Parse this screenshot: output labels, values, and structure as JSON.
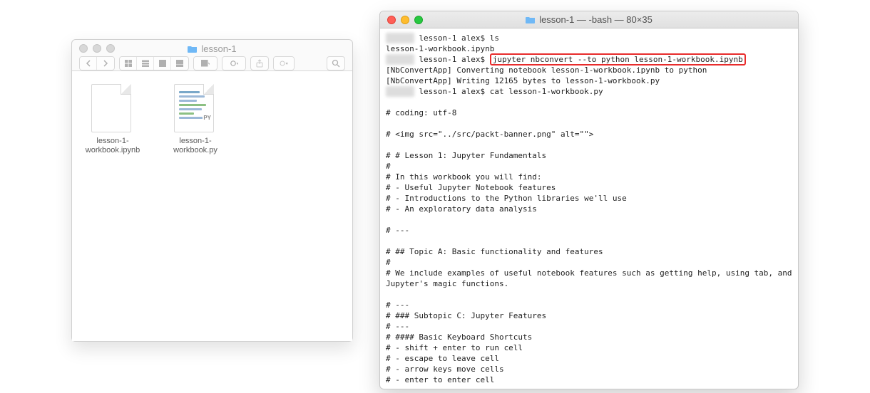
{
  "finder": {
    "title": "lesson-1",
    "files": [
      {
        "name": "lesson-1-workbook.ipynb",
        "kind": "ipynb"
      },
      {
        "name": "lesson-1-workbook.py",
        "kind": "py"
      }
    ]
  },
  "terminal": {
    "title": "lesson-1 — -bash — 80×35",
    "prompt_hidden": "██████",
    "lines": {
      "p1_dir": " lesson-1 alex$ ",
      "p1_cmd": "ls",
      "lsout": "lesson-1-workbook.ipynb",
      "p2_dir": " lesson-1 alex$ ",
      "p2_cmd": "jupyter nbconvert --to python lesson-1-workbook.ipynb",
      "conv1": "[NbConvertApp] Converting notebook lesson-1-workbook.ipynb to python",
      "conv2": "[NbConvertApp] Writing 12165 bytes to lesson-1-workbook.py",
      "p3_dir": " lesson-1 alex$ ",
      "p3_cmd": "cat lesson-1-workbook.py",
      "body": "\n# coding: utf-8\n\n# <img src=\"../src/packt-banner.png\" alt=\"\">\n\n# # Lesson 1: Jupyter Fundamentals\n# \n# In this workbook you will find:\n# - Useful Jupyter Notebook features\n# - Introductions to the Python libraries we'll use\n# - An exploratory data analysis\n\n# ---\n\n# ## Topic A: Basic functionality and features\n# \n# We include examples of useful notebook features such as getting help, using tab, and Jupyter's magic functions.\n\n# ---\n# ### Subtopic C: Jupyter Features\n# ---\n# #### Basic Keyboard Shortcuts\n# - shift + enter to run cell\n# - escape to leave cell\n# - arrow keys move cells\n# - enter to enter cell"
    }
  }
}
